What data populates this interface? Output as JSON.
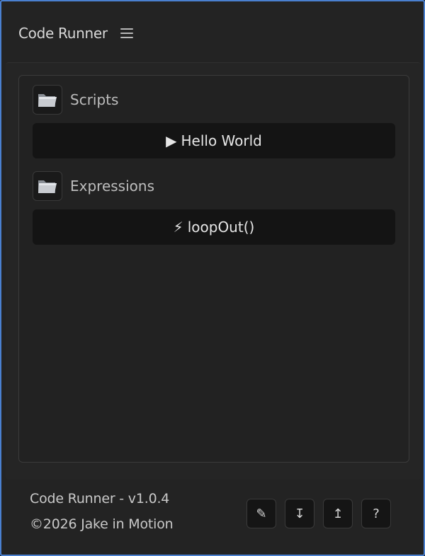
{
  "header": {
    "title": "Code Runner",
    "menu_icon": "hamburger-menu-icon"
  },
  "sections": [
    {
      "label": "Scripts",
      "icon": "folder-icon",
      "buttons": [
        {
          "glyph": "▶",
          "label": "Hello World"
        }
      ]
    },
    {
      "label": "Expressions",
      "icon": "folder-icon",
      "buttons": [
        {
          "glyph": "⚡",
          "label": "loopOut()"
        }
      ]
    }
  ],
  "footer": {
    "version": "Code Runner - v1.0.4",
    "copyright": "©2026 Jake in Motion",
    "tools": [
      {
        "name": "edit-button",
        "icon": "pencil-icon",
        "glyph": "✎"
      },
      {
        "name": "import-button",
        "icon": "download-icon",
        "glyph": "↧"
      },
      {
        "name": "export-button",
        "icon": "upload-icon",
        "glyph": "↥"
      },
      {
        "name": "help-button",
        "icon": "help-icon",
        "glyph": "?"
      }
    ]
  },
  "colors": {
    "accent_border": "#4a80d0",
    "background": "#232323",
    "button_bg": "#141414"
  }
}
